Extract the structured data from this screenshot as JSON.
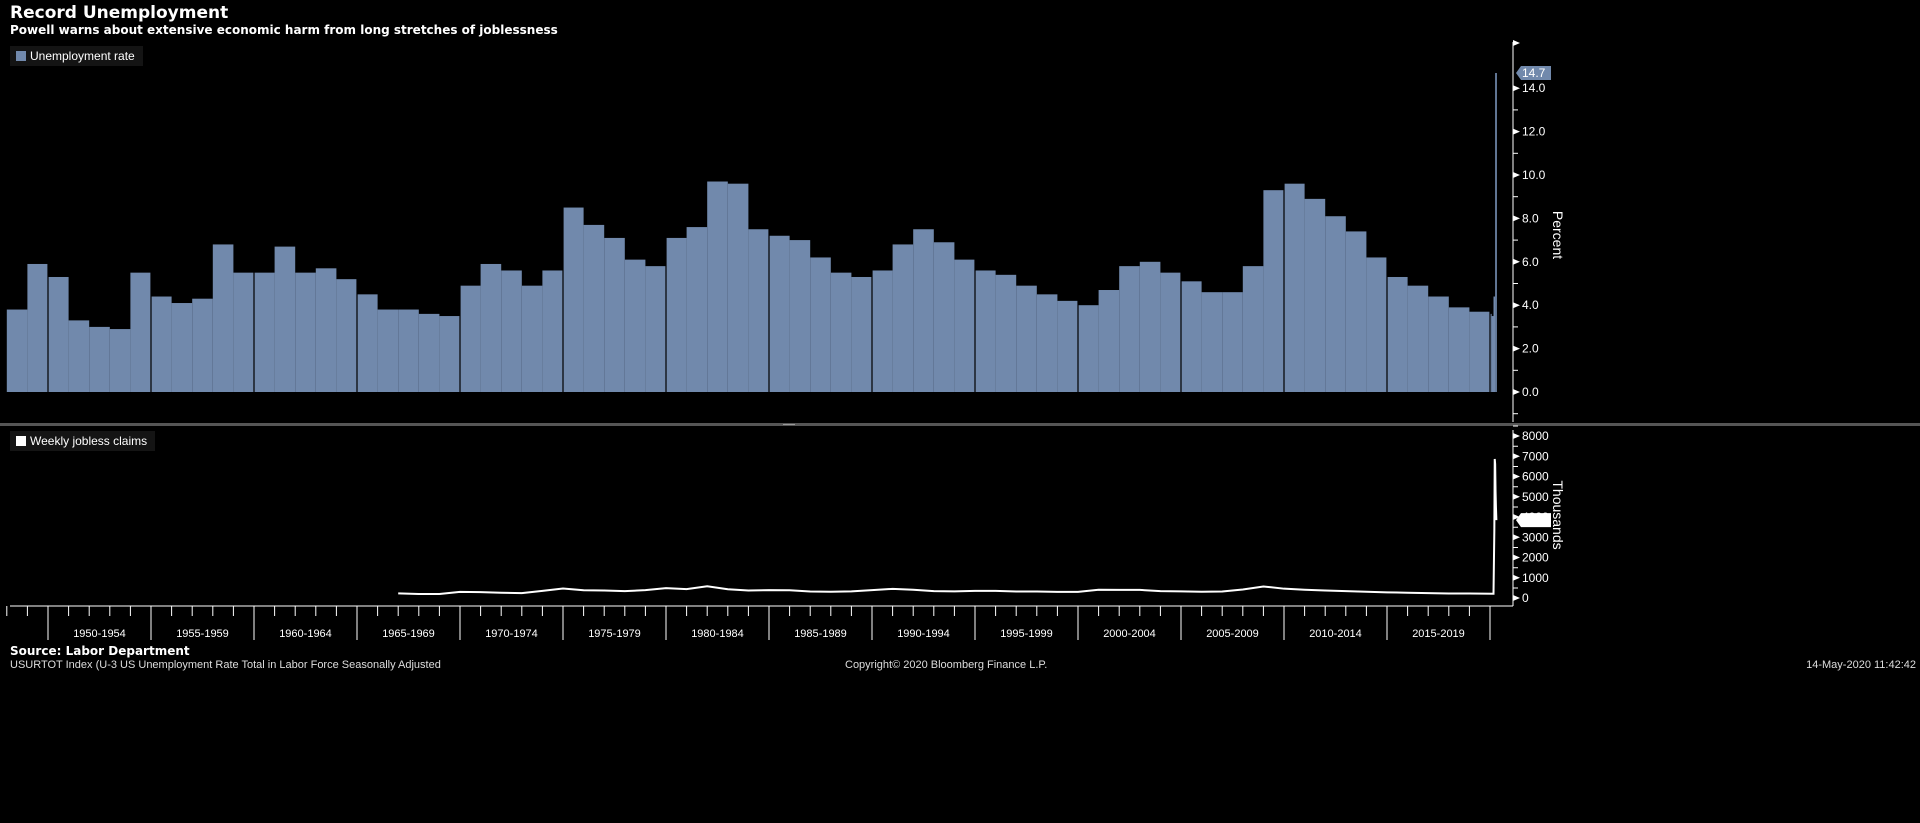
{
  "header": {
    "title": "Record Unemployment",
    "subtitle": "Powell warns about extensive economic harm from long stretches of joblessness"
  },
  "footer": {
    "source": "Source: Labor Department",
    "ticker": "USURTOT Index (U-3 US Unemployment Rate Total in Labor Force Seasonally Adjusted",
    "copyright": "Copyright© 2020 Bloomberg Finance L.P.",
    "timestamp": "14-May-2020 11:42:42"
  },
  "chart_data": [
    {
      "type": "bar",
      "legend": "Unemployment rate",
      "color": "#7189ac",
      "ylabel": "Percent",
      "ylim": [
        -1.5,
        15.5
      ],
      "yticks": [
        "0.0",
        "2.0",
        "4.0",
        "6.0",
        "8.0",
        "10.0",
        "12.0",
        "14.0"
      ],
      "last_value_label": "14.7",
      "x": [
        1948,
        1949,
        1950,
        1951,
        1952,
        1953,
        1954,
        1955,
        1956,
        1957,
        1958,
        1959,
        1960,
        1961,
        1962,
        1963,
        1964,
        1965,
        1966,
        1967,
        1968,
        1969,
        1970,
        1971,
        1972,
        1973,
        1974,
        1975,
        1976,
        1977,
        1978,
        1979,
        1980,
        1981,
        1982,
        1983,
        1984,
        1985,
        1986,
        1987,
        1988,
        1989,
        1990,
        1991,
        1992,
        1993,
        1994,
        1995,
        1996,
        1997,
        1998,
        1999,
        2000,
        2001,
        2002,
        2003,
        2004,
        2005,
        2006,
        2007,
        2008,
        2009,
        2010,
        2011,
        2012,
        2013,
        2014,
        2015,
        2016,
        2017,
        2018,
        2019,
        2020.0,
        2020.08,
        2020.17,
        2020.25
      ],
      "values": [
        3.8,
        5.9,
        5.3,
        3.3,
        3.0,
        2.9,
        5.5,
        4.4,
        4.1,
        4.3,
        6.8,
        5.5,
        5.5,
        6.7,
        5.5,
        5.7,
        5.2,
        4.5,
        3.8,
        3.8,
        3.6,
        3.5,
        4.9,
        5.9,
        5.6,
        4.9,
        5.6,
        8.5,
        7.7,
        7.1,
        6.1,
        5.8,
        7.1,
        7.6,
        9.7,
        9.6,
        7.5,
        7.2,
        7.0,
        6.2,
        5.5,
        5.3,
        5.6,
        6.8,
        7.5,
        6.9,
        6.1,
        5.6,
        5.4,
        4.9,
        4.5,
        4.2,
        4.0,
        4.7,
        5.8,
        6.0,
        5.5,
        5.1,
        4.6,
        4.6,
        5.8,
        9.3,
        9.6,
        8.9,
        8.1,
        7.4,
        6.2,
        5.3,
        4.9,
        4.4,
        3.9,
        3.7,
        3.6,
        3.5,
        4.4,
        14.7
      ]
    },
    {
      "type": "line",
      "legend": "Weekly jobless claims",
      "color": "#ffffff",
      "ylabel": "Thousands",
      "ylim": [
        -300,
        8300
      ],
      "yticks": [
        "0",
        "1000",
        "2000",
        "3000",
        "4000",
        "5000",
        "6000",
        "7000",
        "8000"
      ],
      "last_value_label": "3846",
      "x": [
        1967,
        1968,
        1969,
        1970,
        1971,
        1972,
        1973,
        1974,
        1975,
        1976,
        1977,
        1978,
        1979,
        1980,
        1981,
        1982,
        1983,
        1984,
        1985,
        1986,
        1987,
        1988,
        1989,
        1990,
        1991,
        1992,
        1993,
        1994,
        1995,
        1996,
        1997,
        1998,
        1999,
        2000,
        2001,
        2002,
        2003,
        2004,
        2005,
        2006,
        2007,
        2008,
        2009,
        2010,
        2011,
        2012,
        2013,
        2014,
        2015,
        2016,
        2017,
        2018,
        2019,
        2020.17,
        2020.21,
        2020.23,
        2020.25,
        2020.27,
        2020.29,
        2020.31
      ],
      "values": [
        230,
        200,
        200,
        300,
        290,
        260,
        240,
        350,
        470,
        380,
        370,
        340,
        390,
        490,
        440,
        580,
        430,
        370,
        390,
        380,
        320,
        310,
        330,
        390,
        450,
        410,
        340,
        330,
        350,
        350,
        320,
        320,
        300,
        300,
        410,
        400,
        400,
        340,
        330,
        310,
        320,
        420,
        570,
        460,
        410,
        370,
        340,
        310,
        280,
        260,
        240,
        220,
        220,
        210,
        3307,
        6867,
        6615,
        5237,
        4442,
        3846
      ]
    }
  ],
  "xaxis": {
    "labels": [
      "1950-1954",
      "1955-1959",
      "1960-1964",
      "1965-1969",
      "1970-1974",
      "1975-1979",
      "1980-1984",
      "1985-1989",
      "1990-1994",
      "1995-1999",
      "2000-2004",
      "2005-2009",
      "2010-2014",
      "2015-2019"
    ],
    "starts": [
      1950,
      1955,
      1960,
      1965,
      1970,
      1975,
      1980,
      1985,
      1990,
      1995,
      2000,
      2005,
      2010,
      2015,
      2020
    ]
  }
}
